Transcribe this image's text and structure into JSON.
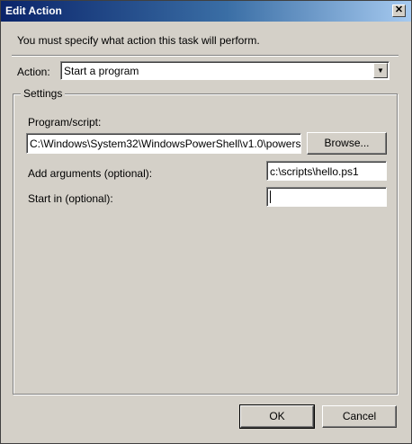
{
  "window": {
    "title": "Edit Action",
    "close_glyph": "✕"
  },
  "intro_text": "You must specify what action this task will perform.",
  "action": {
    "label": "Action:",
    "selected": "Start a program",
    "arrow_glyph": "▼"
  },
  "settings": {
    "legend": "Settings",
    "program_label": "Program/script:",
    "program_value": "C:\\Windows\\System32\\WindowsPowerShell\\v1.0\\powers",
    "browse_label": "Browse...",
    "arguments_label": "Add arguments (optional):",
    "arguments_value": "c:\\scripts\\hello.ps1",
    "start_in_label": "Start in (optional):",
    "start_in_value": ""
  },
  "buttons": {
    "ok": "OK",
    "cancel": "Cancel"
  }
}
